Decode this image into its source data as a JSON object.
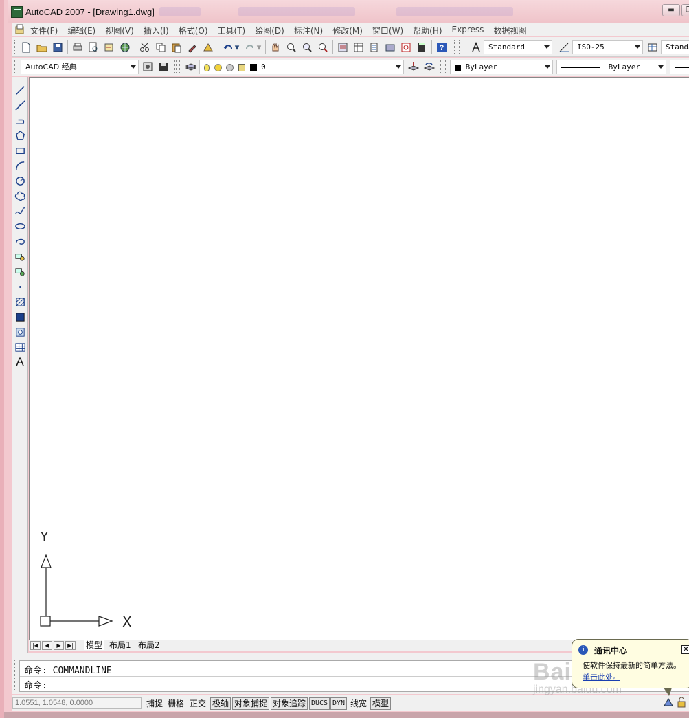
{
  "window": {
    "title": "AutoCAD 2007 - [Drawing1.dwg]"
  },
  "menubar": {
    "items": [
      "文件(F)",
      "编辑(E)",
      "视图(V)",
      "插入(I)",
      "格式(O)",
      "工具(T)",
      "绘图(D)",
      "标注(N)",
      "修改(M)",
      "窗口(W)",
      "帮助(H)",
      "Express",
      "数据视图"
    ]
  },
  "toolbar1": {
    "text_style": "Standard",
    "dim_style": "ISO-25",
    "table_style": "Standard"
  },
  "toolbar2": {
    "workspace": "AutoCAD 经典",
    "layer": "0",
    "color": "ByLayer",
    "linetype": "ByLayer"
  },
  "ucs": {
    "y_label": "Y",
    "x_label": "X"
  },
  "layout_tabs": {
    "items": [
      "模型",
      "布局1",
      "布局2"
    ],
    "active": "模型"
  },
  "command": {
    "line1": "命令: COMMANDLINE",
    "line2": "命令:"
  },
  "statusbar": {
    "coords": "1.0551, 1.0548, 0.0000",
    "buttons": [
      "捕捉",
      "栅格",
      "正交",
      "极轴",
      "对象捕捉",
      "对象追踪",
      "DUCS",
      "DYN",
      "线宽",
      "模型"
    ]
  },
  "balloon": {
    "title": "通讯中心",
    "text": "使软件保持最新的简单方法。",
    "link": "单击此处。"
  },
  "watermark": {
    "main": "Bai百度",
    "sub": "jingyan.baidu.com"
  }
}
